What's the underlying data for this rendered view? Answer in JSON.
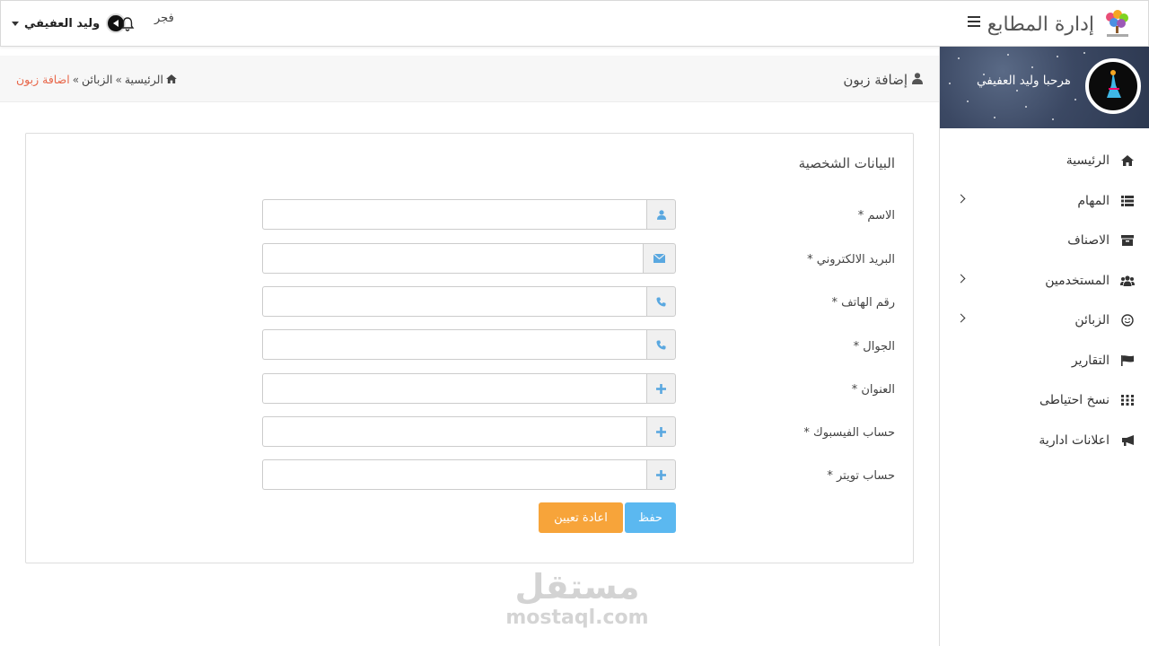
{
  "header": {
    "brand_title": "إدارة المطابع",
    "user_name": "وليد العفيفي",
    "prayer_label": "فجر"
  },
  "sidebar": {
    "welcome": "مرحبا وليد العفيفي",
    "items": [
      {
        "label": "الرئيسية",
        "icon": "home-icon",
        "has_children": false
      },
      {
        "label": "المهام",
        "icon": "list-icon",
        "has_children": true
      },
      {
        "label": "الاصناف",
        "icon": "archive-icon",
        "has_children": false
      },
      {
        "label": "المستخدمين",
        "icon": "users-icon",
        "has_children": true
      },
      {
        "label": "الزبائن",
        "icon": "smile-icon",
        "has_children": true
      },
      {
        "label": "التقارير",
        "icon": "flag-icon",
        "has_children": false
      },
      {
        "label": "نسخ احتياطى",
        "icon": "grid-icon",
        "has_children": false
      },
      {
        "label": "اعلانات ادارية",
        "icon": "bullhorn-icon",
        "has_children": false
      }
    ]
  },
  "page": {
    "title": "إضافة زبون",
    "breadcrumb": {
      "home": "الرئيسية",
      "customers": "الزبائن",
      "current": "اضافة زبون"
    }
  },
  "form": {
    "section_title": "البيانات الشخصية",
    "fields": [
      {
        "label": "الاسم *",
        "icon": "user-icon",
        "value": ""
      },
      {
        "label": "البريد الالكتروني *",
        "icon": "envelope-icon",
        "value": ""
      },
      {
        "label": "رقم الهاتف *",
        "icon": "phone-icon",
        "value": ""
      },
      {
        "label": "الجوال *",
        "icon": "phone-icon",
        "value": ""
      },
      {
        "label": "العنوان *",
        "icon": "plus-icon",
        "value": ""
      },
      {
        "label": "حساب الفيسبوك *",
        "icon": "plus-icon",
        "value": ""
      },
      {
        "label": "حساب تويتر *",
        "icon": "plus-icon",
        "value": ""
      }
    ],
    "save_label": "حفظ",
    "reset_label": "اعادة تعيين"
  },
  "watermark": {
    "arabic": "مستقل",
    "latin": "mostaql.com"
  },
  "colors": {
    "accent_blue": "#5bb8f0",
    "reset_orange": "#f7a43a",
    "breadcrumb_active": "#e8674a",
    "sidebar_header": "#3b4863"
  }
}
